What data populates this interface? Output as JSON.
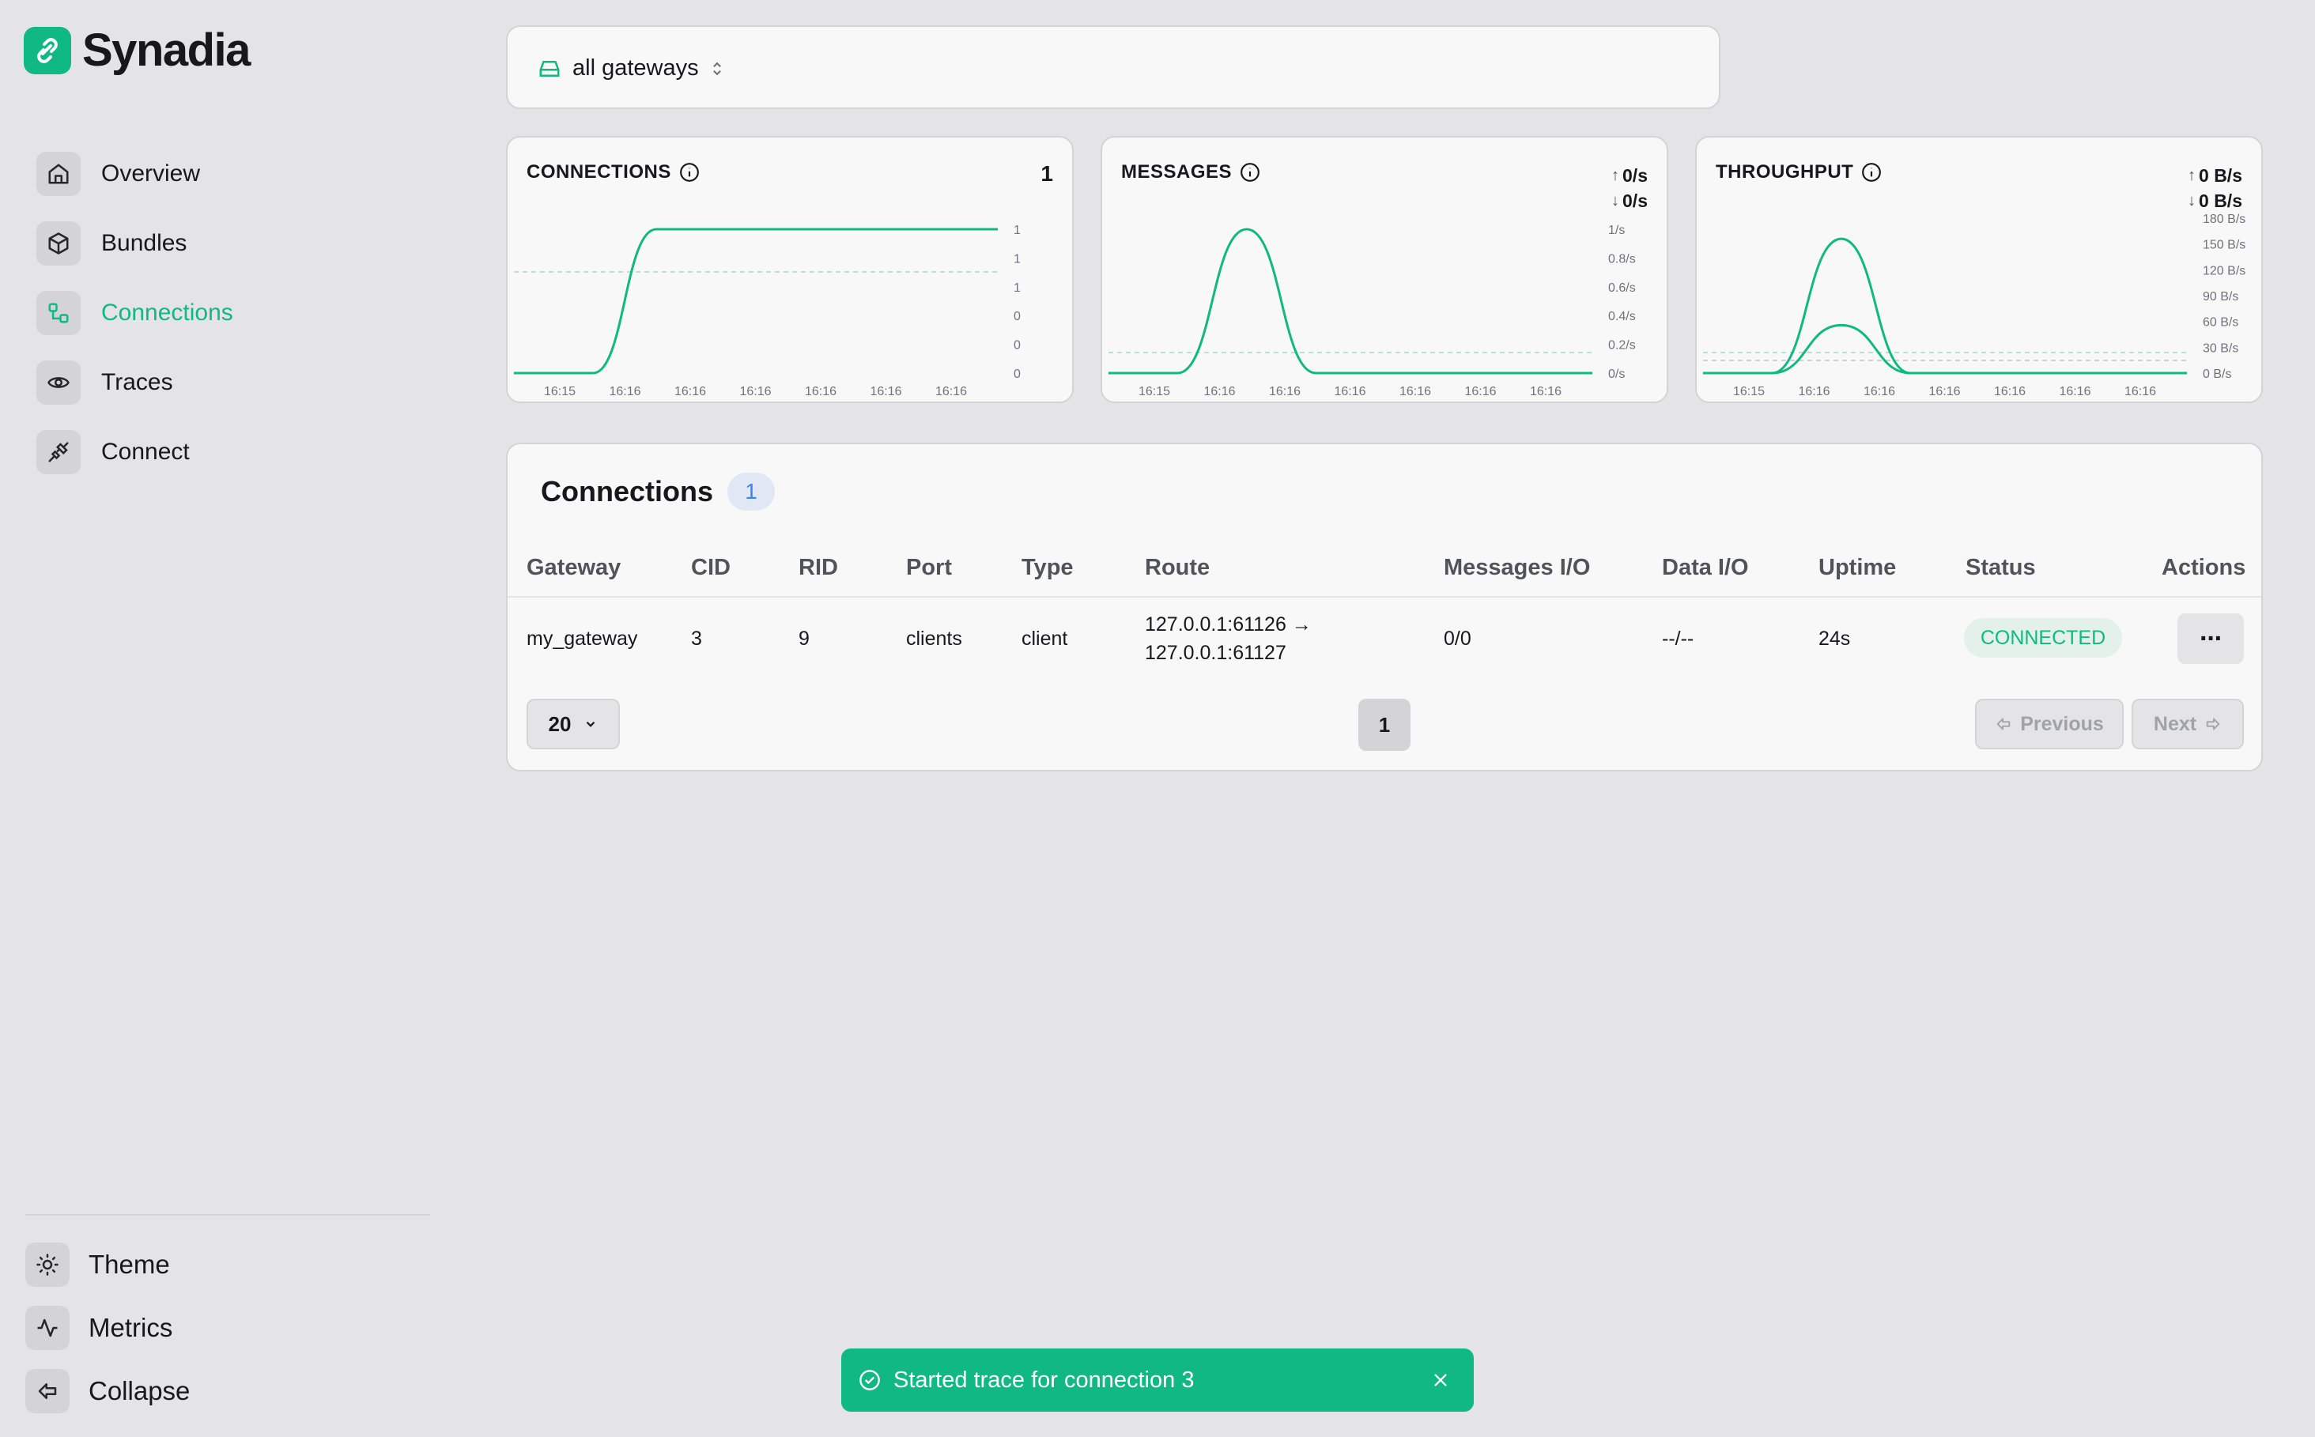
{
  "app": {
    "name": "Synadia"
  },
  "sidebar": {
    "items": [
      {
        "label": "Overview",
        "icon": "home-icon"
      },
      {
        "label": "Bundles",
        "icon": "box-icon"
      },
      {
        "label": "Connections",
        "icon": "connections-icon",
        "active": true
      },
      {
        "label": "Traces",
        "icon": "eye-icon"
      },
      {
        "label": "Connect",
        "icon": "plug-icon"
      }
    ],
    "bottom": [
      {
        "label": "Theme",
        "icon": "sun-icon"
      },
      {
        "label": "Metrics",
        "icon": "activity-icon"
      },
      {
        "label": "Collapse",
        "icon": "collapse-icon"
      }
    ]
  },
  "gateway_selector": {
    "label": "all gateways"
  },
  "charts": {
    "connections": {
      "title": "CONNECTIONS",
      "value": "1"
    },
    "messages": {
      "title": "MESSAGES",
      "up": "0/s",
      "down": "0/s"
    },
    "throughput": {
      "title": "THROUGHPUT",
      "up": "0 B/s",
      "down": "0 B/s"
    }
  },
  "chart_data": [
    {
      "type": "line",
      "title": "CONNECTIONS",
      "x": [
        "16:15",
        "16:16",
        "16:16",
        "16:16",
        "16:16",
        "16:16",
        "16:16"
      ],
      "y_ticks": [
        "1",
        "1",
        "1",
        "0",
        "0",
        "0"
      ],
      "ylim": [
        0,
        1
      ],
      "series": [
        {
          "values": [
            0,
            0,
            1,
            1,
            1,
            1,
            1,
            1
          ]
        }
      ]
    },
    {
      "type": "line",
      "title": "MESSAGES",
      "x": [
        "16:15",
        "16:16",
        "16:16",
        "16:16",
        "16:16",
        "16:16",
        "16:16"
      ],
      "y_ticks": [
        "1/s",
        "0.8/s",
        "0.6/s",
        "0.4/s",
        "0.2/s",
        "0/s"
      ],
      "ylim": [
        0,
        1
      ],
      "series": [
        {
          "values": [
            0,
            0,
            1,
            0,
            0,
            0,
            0,
            0
          ]
        }
      ]
    },
    {
      "type": "line",
      "title": "THROUGHPUT",
      "x": [
        "16:15",
        "16:16",
        "16:16",
        "16:16",
        "16:16",
        "16:16",
        "16:16"
      ],
      "y_ticks": [
        "180 B/s",
        "150 B/s",
        "120 B/s",
        "90 B/s",
        "60 B/s",
        "30 B/s",
        "0 B/s"
      ],
      "ylim": [
        0,
        180
      ],
      "series": [
        {
          "values": [
            0,
            0,
            168,
            0,
            0,
            0,
            0,
            0
          ]
        },
        {
          "values": [
            0,
            0,
            60,
            0,
            0,
            0,
            0,
            0
          ]
        }
      ]
    }
  ],
  "table": {
    "title": "Connections",
    "count": "1",
    "columns": [
      "Gateway",
      "CID",
      "RID",
      "Port",
      "Type",
      "Route",
      "Messages I/O",
      "Data I/O",
      "Uptime",
      "Status",
      "Actions"
    ],
    "rows": [
      {
        "gateway": "my_gateway",
        "cid": "3",
        "rid": "9",
        "port": "clients",
        "type": "client",
        "route_from": "127.0.0.1:61126 →",
        "route_to": "127.0.0.1:61127",
        "messages_io": "0/0",
        "data_io": "--/--",
        "uptime": "24s",
        "status": "CONNECTED",
        "actions": "···"
      }
    ],
    "page_size": "20",
    "current_page": "1",
    "prev_label": "Previous",
    "next_label": "Next"
  },
  "toast": {
    "message": "Started trace for connection 3"
  },
  "colors": {
    "accent": "#10b981",
    "badge_blue": "#3b82f6",
    "background": "#e4e4e6"
  }
}
